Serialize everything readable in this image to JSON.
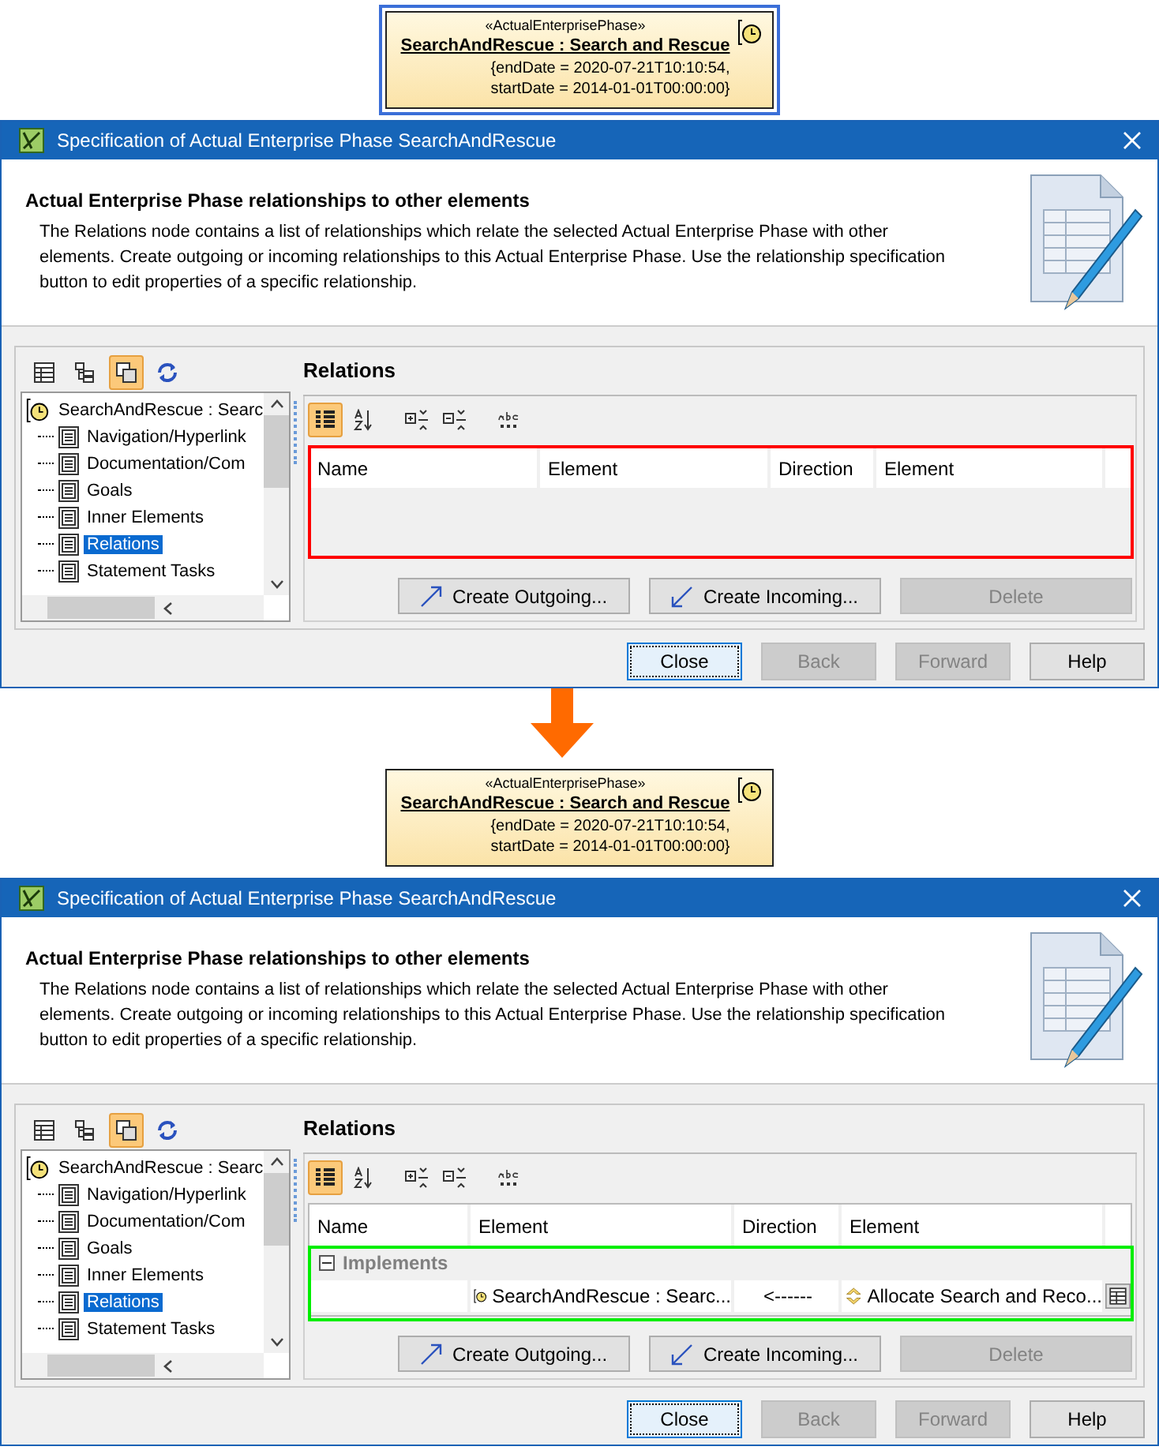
{
  "panels": [
    {
      "element": {
        "stereotype": "«ActualEnterprisePhase»",
        "name": "SearchAndRescue : Search and Rescue",
        "tags": [
          "{endDate = 2020-07-21T10:10:54,",
          "startDate = 2014-01-01T00:00:00}"
        ],
        "selected": true
      },
      "dialog": {
        "title": "Specification of Actual Enterprise Phase SearchAndRescue",
        "heading": "Actual Enterprise Phase relationships to other elements",
        "description": "The Relations node contains a list of relationships which relate the selected Actual Enterprise Phase with other elements. Create outgoing or incoming relationships to this Actual Enterprise Phase. Use the relationship specification button to edit properties of a specific relationship.",
        "tree_toolbar": [
          {
            "kind": "table",
            "selected": false
          },
          {
            "kind": "tree",
            "selected": false
          },
          {
            "kind": "copy",
            "selected": true
          },
          {
            "kind": "refresh",
            "selected": false
          }
        ],
        "tree": {
          "root": "SearchAndRescue : Searc",
          "children": [
            {
              "label": "Navigation/Hyperlink",
              "selected": false
            },
            {
              "label": "Documentation/Com",
              "selected": false
            },
            {
              "label": "Goals",
              "selected": false
            },
            {
              "label": "Inner Elements",
              "selected": false
            },
            {
              "label": "Relations",
              "selected": true
            },
            {
              "label": "Statement Tasks",
              "selected": false
            }
          ]
        },
        "section_title": "Relations",
        "table_toolbar": [
          {
            "kind": "grouped",
            "selected": true
          },
          {
            "kind": "sort",
            "selected": false
          },
          {
            "kind": "expand",
            "selected": false
          },
          {
            "kind": "collapse",
            "selected": false
          },
          {
            "kind": "abc",
            "selected": false
          }
        ],
        "table": {
          "columns": [
            "Name",
            "Element",
            "Direction",
            "Element"
          ],
          "highlight": {
            "kind": "table",
            "color": "#ff0000"
          }
        },
        "buttons": [
          {
            "kind": "outgoing",
            "label": "Create Outgoing...",
            "disabled": false
          },
          {
            "kind": "incoming",
            "label": "Create Incoming...",
            "disabled": false
          },
          {
            "kind": "plain",
            "label": "Delete",
            "disabled": true
          }
        ],
        "footer_buttons": [
          {
            "label": "Close",
            "disabled": false,
            "focused": true
          },
          {
            "label": "Back",
            "disabled": true,
            "focused": false
          },
          {
            "label": "Forward",
            "disabled": true,
            "focused": false
          },
          {
            "label": "Help",
            "disabled": false,
            "focused": false
          }
        ]
      }
    },
    {
      "element": {
        "stereotype": "«ActualEnterprisePhase»",
        "name": "SearchAndRescue : Search and Rescue",
        "tags": [
          "{endDate = 2020-07-21T10:10:54,",
          "startDate = 2014-01-01T00:00:00}"
        ],
        "selected": false
      },
      "dialog": {
        "title": "Specification of Actual Enterprise Phase SearchAndRescue",
        "heading": "Actual Enterprise Phase relationships to other elements",
        "description": "The Relations node contains a list of relationships which relate the selected Actual Enterprise Phase with other elements. Create outgoing or incoming relationships to this Actual Enterprise Phase. Use the relationship specification button to edit properties of a specific relationship.",
        "tree_toolbar": [
          {
            "kind": "table",
            "selected": false
          },
          {
            "kind": "tree",
            "selected": false
          },
          {
            "kind": "copy",
            "selected": true
          },
          {
            "kind": "refresh",
            "selected": false
          }
        ],
        "tree": {
          "root": "SearchAndRescue : Searc",
          "children": [
            {
              "label": "Navigation/Hyperlink",
              "selected": false
            },
            {
              "label": "Documentation/Com",
              "selected": false
            },
            {
              "label": "Goals",
              "selected": false
            },
            {
              "label": "Inner Elements",
              "selected": false
            },
            {
              "label": "Relations",
              "selected": true
            },
            {
              "label": "Statement Tasks",
              "selected": false
            }
          ]
        },
        "section_title": "Relations",
        "table_toolbar": [
          {
            "kind": "grouped",
            "selected": true
          },
          {
            "kind": "sort",
            "selected": false
          },
          {
            "kind": "expand",
            "selected": false
          },
          {
            "kind": "collapse",
            "selected": false
          },
          {
            "kind": "abc",
            "selected": false
          }
        ],
        "table": {
          "columns": [
            "Name",
            "Element",
            "Direction",
            "Element"
          ],
          "highlight": {
            "kind": "rows",
            "color": "#00ee00"
          },
          "groups": [
            {
              "label": "Implements",
              "expanded": true,
              "rows": [
                {
                  "source": "SearchAndRescue : Searc...",
                  "direction": "<------",
                  "target": "Allocate Search and Reco..."
                }
              ]
            }
          ]
        },
        "buttons": [
          {
            "kind": "outgoing",
            "label": "Create Outgoing...",
            "disabled": false
          },
          {
            "kind": "incoming",
            "label": "Create Incoming...",
            "disabled": false
          },
          {
            "kind": "plain",
            "label": "Delete",
            "disabled": true
          }
        ],
        "footer_buttons": [
          {
            "label": "Close",
            "disabled": false,
            "focused": true
          },
          {
            "label": "Back",
            "disabled": true,
            "focused": false
          },
          {
            "label": "Forward",
            "disabled": true,
            "focused": false
          },
          {
            "label": "Help",
            "disabled": false,
            "focused": false
          }
        ]
      }
    }
  ]
}
